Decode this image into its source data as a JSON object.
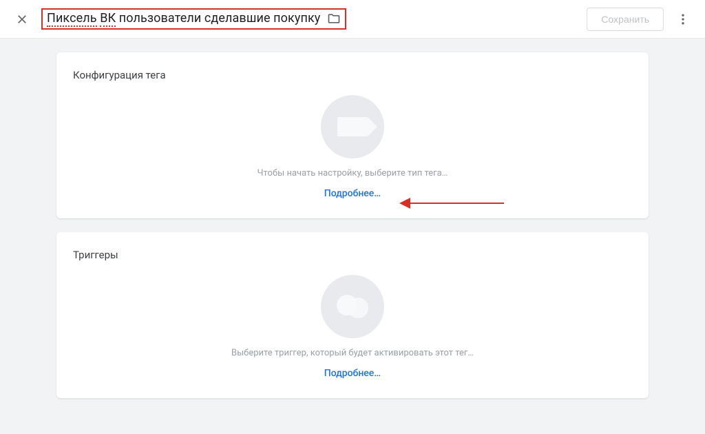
{
  "header": {
    "title_full": "Пиксель ВК пользователи сделавшие покупку",
    "title_word1": "Пиксель",
    "title_word2": "ВК",
    "title_rest": " пользователи сделавшие покупку",
    "save_label": "Сохранить"
  },
  "cards": {
    "tag_config": {
      "title": "Конфигурация тега",
      "hint": "Чтобы начать настройку, выберите тип тега…",
      "learn_more": "Подробнее…"
    },
    "triggers": {
      "title": "Триггеры",
      "hint": "Выберите триггер, который будет активировать этот тег…",
      "learn_more": "Подробнее…"
    }
  },
  "colors": {
    "accent": "#1a73e8",
    "annotation_red": "#d93025",
    "bg": "#f1f3f4",
    "muted": "#9aa0a6"
  }
}
